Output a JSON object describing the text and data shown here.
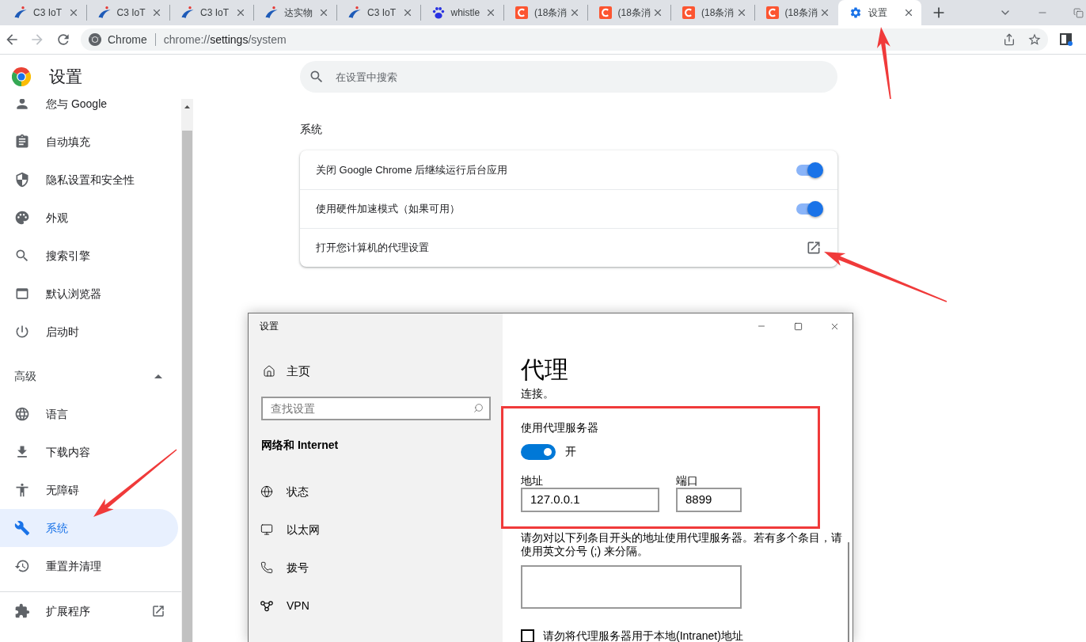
{
  "tabs": [
    {
      "kind": "swirl",
      "title": "C3 IoT",
      "selected": false
    },
    {
      "kind": "swirl",
      "title": "C3 IoT",
      "selected": false
    },
    {
      "kind": "swirl",
      "title": "C3 IoT",
      "selected": false
    },
    {
      "kind": "swirl",
      "title": "达实物",
      "selected": false
    },
    {
      "kind": "swirl",
      "title": "C3 IoT",
      "selected": false
    },
    {
      "kind": "paw",
      "title": "whistle",
      "selected": false
    },
    {
      "kind": "c-mark",
      "title": "(18条消",
      "selected": false
    },
    {
      "kind": "c-mark",
      "title": "(18条消",
      "selected": false
    },
    {
      "kind": "c-mark",
      "title": "(18条消",
      "selected": false
    },
    {
      "kind": "c-mark",
      "title": "(18条消",
      "selected": false
    },
    {
      "kind": "gear",
      "title": "设置",
      "selected": true
    }
  ],
  "toolbar": {
    "back": {
      "disabled": false
    },
    "forward": {
      "disabled": true
    },
    "omnibox": {
      "chip": "Chrome",
      "url": {
        "scheme": "chrome://",
        "host": "settings",
        "path": "/system"
      }
    }
  },
  "sidebar": {
    "title": "设置",
    "items": [
      {
        "label": "您与 Google",
        "selected": false
      },
      {
        "label": "自动填充",
        "selected": false
      },
      {
        "label": "隐私设置和安全性",
        "selected": false
      },
      {
        "label": "外观",
        "selected": false
      },
      {
        "label": "搜索引擎",
        "selected": false
      },
      {
        "label": "默认浏览器",
        "selected": false
      },
      {
        "label": "启动时",
        "selected": false
      }
    ],
    "advanced": {
      "label": "高级",
      "expanded": true,
      "items": [
        {
          "label": "语言",
          "selected": false
        },
        {
          "label": "下载内容",
          "selected": false
        },
        {
          "label": "无障碍",
          "selected": false
        },
        {
          "label": "系统",
          "selected": true
        },
        {
          "label": "重置并清理",
          "selected": false
        }
      ]
    },
    "extensions": {
      "label": "扩展程序"
    }
  },
  "search": {
    "placeholder": "在设置中搜索"
  },
  "section": {
    "title": "系统",
    "rows": [
      {
        "kind": "toggle",
        "label": "关闭 Google Chrome 后继续运行后台应用",
        "on": true
      },
      {
        "kind": "toggle",
        "label": "使用硬件加速模式（如果可用）",
        "on": true
      },
      {
        "kind": "link",
        "label": "打开您计算机的代理设置"
      }
    ]
  },
  "dialog": {
    "title": "设置",
    "home": "主页",
    "search": {
      "placeholder": "查找设置"
    },
    "category": "网络和 Internet",
    "nav": [
      {
        "label": "状态",
        "selected": false
      },
      {
        "label": "以太网",
        "selected": false
      },
      {
        "label": "拨号",
        "selected": false
      },
      {
        "label": "VPN",
        "selected": false
      }
    ],
    "page": {
      "title": "代理",
      "intro_tail": "连接。",
      "proxy": {
        "heading": "使用代理服务器",
        "on": true,
        "state_label": "开",
        "address": {
          "label": "地址",
          "value": "127.0.0.1"
        },
        "port": {
          "label": "端口",
          "value": "8899"
        }
      },
      "exceptions": {
        "description": "请勿对以下列条目开头的地址使用代理服务器。若有多个条目，请使用英文分号 (;) 来分隔。"
      },
      "bypass_local": {
        "label": "请勿将代理服务器用于本地(Intranet)地址",
        "checked": false
      }
    }
  }
}
